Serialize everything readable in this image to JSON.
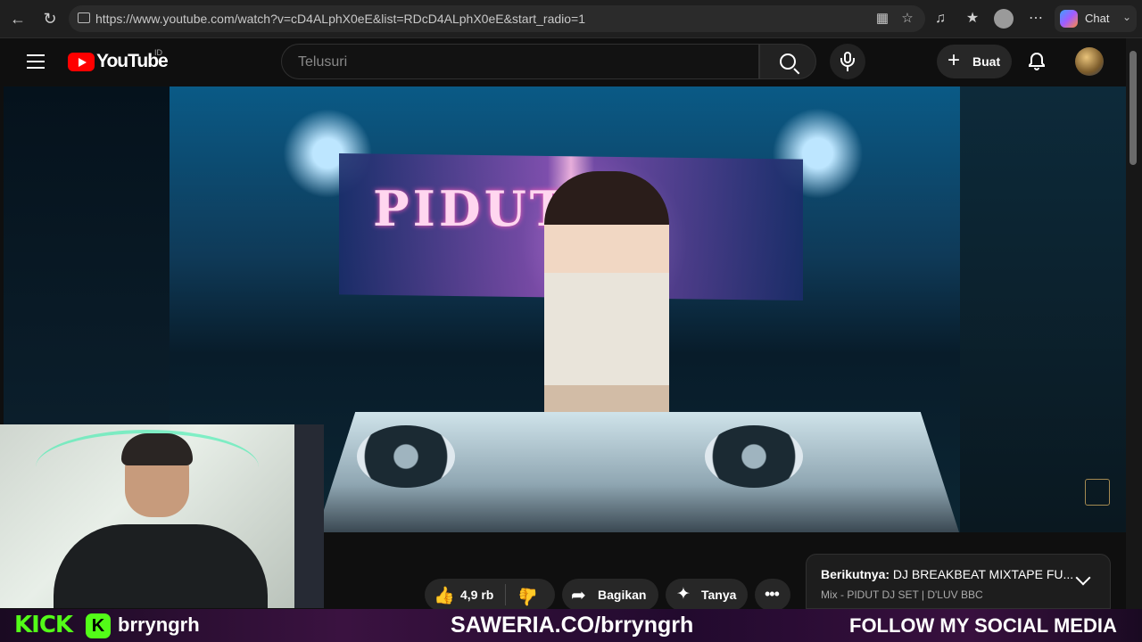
{
  "browser": {
    "url": "https://www.youtube.com/watch?v=cD4ALphX0eE&list=RDcD4ALphX0eE&start_radio=1",
    "chat_label": "Chat",
    "icons": [
      "back-icon",
      "refresh-icon",
      "lock-icon",
      "app-icon",
      "star-icon",
      "media-icon",
      "favorites-icon",
      "profile-icon",
      "more-icon",
      "copilot-icon"
    ]
  },
  "youtube": {
    "brand": "YouTube",
    "country": "ID",
    "search_placeholder": "Telusuri",
    "create_label": "Buat"
  },
  "video": {
    "screen_text": "PIDUT"
  },
  "actions": {
    "like_count": "4,9 rb",
    "share_label": "Bagikan",
    "ask_label": "Tanya"
  },
  "up_next": {
    "label": "Berikutnya:",
    "title": "DJ BREAKBEAT MIXTAPE FU...",
    "subtitle": "Mix - PIDUT DJ SET | D'LUV BBC"
  },
  "overlay": {
    "kick_text": "KICK",
    "kick_user": "brryngrh",
    "saweria": "SAWERIA.CO/brryngrh",
    "follow": "FOLLOW MY SOCIAL MEDIA"
  },
  "colors": {
    "yt_red": "#ff0000",
    "kick_green": "#53fc18",
    "background": "#0f0f0f"
  }
}
